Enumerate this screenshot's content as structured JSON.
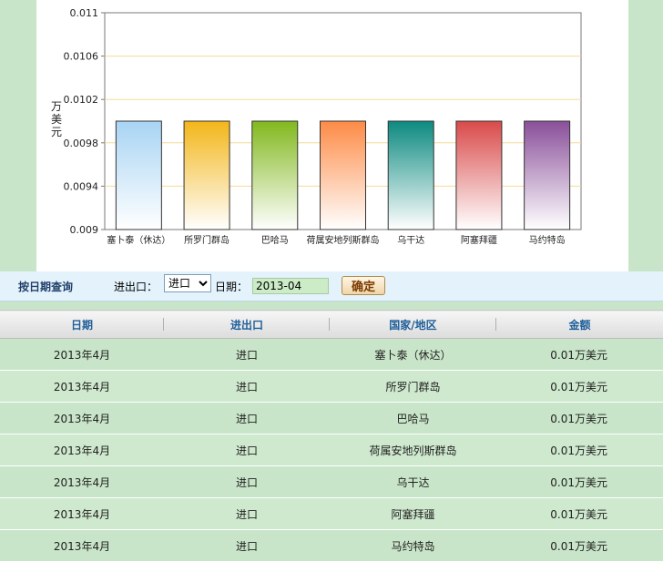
{
  "chart_data": {
    "type": "bar",
    "categories": [
      "塞卜泰（休达）",
      "所罗门群岛",
      "巴哈马",
      "荷属安地列斯群岛",
      "乌干达",
      "阿塞拜疆",
      "马约特岛"
    ],
    "values": [
      0.01,
      0.01,
      0.01,
      0.01,
      0.01,
      0.01,
      0.01
    ],
    "ylabel": "万美元",
    "ylim": [
      0.009,
      0.011
    ],
    "yticks": [
      "0.011",
      "0.0106",
      "0.0102",
      "0.0098",
      "0.0094",
      "0.009"
    ],
    "bar_colors": [
      "#a8d4f4",
      "#f3b619",
      "#82b81e",
      "#fd8b46",
      "#0c8a80",
      "#d94a4a",
      "#8a4f9a"
    ]
  },
  "query": {
    "title": "按日期查询",
    "io_label": "进出口：",
    "io_value": "进口",
    "date_label": "日期：",
    "date_value": "2013-04",
    "confirm_label": "确定"
  },
  "table": {
    "headers": [
      "日期",
      "进出口",
      "国家/地区",
      "金额"
    ],
    "rows": [
      [
        "2013年4月",
        "进口",
        "塞卜泰（休达）",
        "0.01万美元"
      ],
      [
        "2013年4月",
        "进口",
        "所罗门群岛",
        "0.01万美元"
      ],
      [
        "2013年4月",
        "进口",
        "巴哈马",
        "0.01万美元"
      ],
      [
        "2013年4月",
        "进口",
        "荷属安地列斯群岛",
        "0.01万美元"
      ],
      [
        "2013年4月",
        "进口",
        "乌干达",
        "0.01万美元"
      ],
      [
        "2013年4月",
        "进口",
        "阿塞拜疆",
        "0.01万美元"
      ],
      [
        "2013年4月",
        "进口",
        "马约特岛",
        "0.01万美元"
      ]
    ]
  }
}
